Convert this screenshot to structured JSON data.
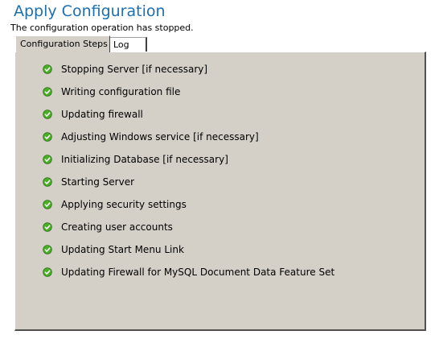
{
  "header": {
    "title": "Apply Configuration",
    "status": "The configuration operation has stopped."
  },
  "tabs": [
    {
      "label": "Configuration Steps",
      "selected": true
    },
    {
      "label": "Log",
      "selected": false
    }
  ],
  "steps": [
    {
      "label": "Stopping Server [if necessary]",
      "status": "complete",
      "icon": "check-circle-icon"
    },
    {
      "label": "Writing configuration file",
      "status": "complete",
      "icon": "check-circle-icon"
    },
    {
      "label": "Updating firewall",
      "status": "complete",
      "icon": "check-circle-icon"
    },
    {
      "label": "Adjusting Windows service [if necessary]",
      "status": "complete",
      "icon": "check-circle-icon"
    },
    {
      "label": "Initializing Database [if necessary]",
      "status": "complete",
      "icon": "check-circle-icon"
    },
    {
      "label": "Starting Server",
      "status": "complete",
      "icon": "check-circle-icon"
    },
    {
      "label": "Applying security settings",
      "status": "complete",
      "icon": "check-circle-icon"
    },
    {
      "label": "Creating user accounts",
      "status": "complete",
      "icon": "check-circle-icon"
    },
    {
      "label": "Updating Start Menu Link",
      "status": "complete",
      "icon": "check-circle-icon"
    },
    {
      "label": "Updating Firewall for MySQL Document Data Feature Set",
      "status": "complete",
      "icon": "check-circle-icon"
    }
  ],
  "colors": {
    "title": "#1e6fb0",
    "panel_bg": "#d4d0c8",
    "check_fill": "#4caf2a",
    "check_stroke": "#2f7a17"
  }
}
